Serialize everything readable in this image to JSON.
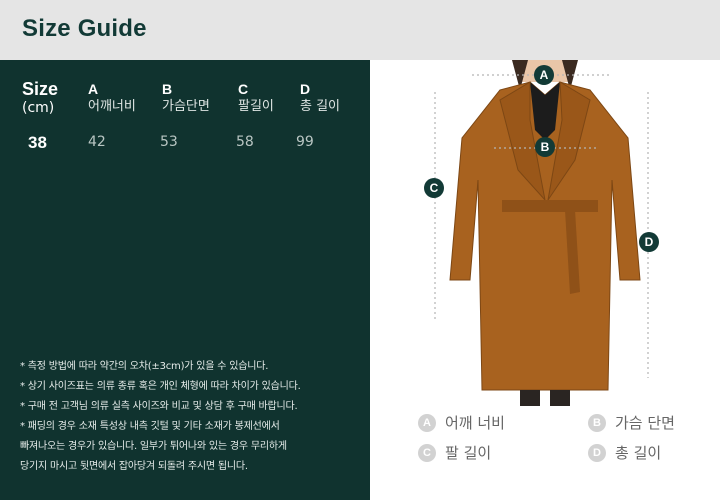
{
  "header": {
    "title": "Size Guide"
  },
  "table": {
    "size_label": "Size",
    "unit_label": "(cm)",
    "columns": [
      {
        "letter": "A",
        "name": "어깨너비"
      },
      {
        "letter": "B",
        "name": "가슴단면"
      },
      {
        "letter": "C",
        "name": "팔길이"
      },
      {
        "letter": "D",
        "name": "총 길이"
      }
    ],
    "rows": [
      {
        "size": "38",
        "values": [
          "42",
          "53",
          "58",
          "99"
        ]
      }
    ]
  },
  "notes": [
    "* 측정 방법에 따라 약간의 오차(±3cm)가 있을 수 있습니다.",
    "* 상기 사이즈표는 의류 종류 혹은 개인 체형에 따라 차이가 있습니다.",
    "* 구매 전 고객님 의류 실측 사이즈와 비교 및 상담 후 구매 바랍니다.",
    "* 패딩의 경우 소재 특성상 내측 깃털 및 기타 소재가 봉제선에서",
    "빠져나오는 경우가 있습니다. 일부가 튀어나와 있는 경우 무리하게",
    "당기지 마시고 뒷면에서 잡아당겨 되돌려 주시면 됩니다."
  ],
  "figure": {
    "markers": {
      "a": "A",
      "b": "B",
      "c": "C",
      "d": "D"
    },
    "legend": [
      {
        "letter": "A",
        "label": "어깨 너비"
      },
      {
        "letter": "B",
        "label": "가슴 단면"
      },
      {
        "letter": "C",
        "label": "팔 길이"
      },
      {
        "letter": "D",
        "label": "총 길이"
      }
    ]
  },
  "colors": {
    "panel": "#10332f",
    "coat": "#a8621f",
    "marker": "#123a36"
  },
  "icons": {
    "measurement_marker": "lettered-circle-icon",
    "coat_image": "camel-wrap-coat-illustration"
  }
}
